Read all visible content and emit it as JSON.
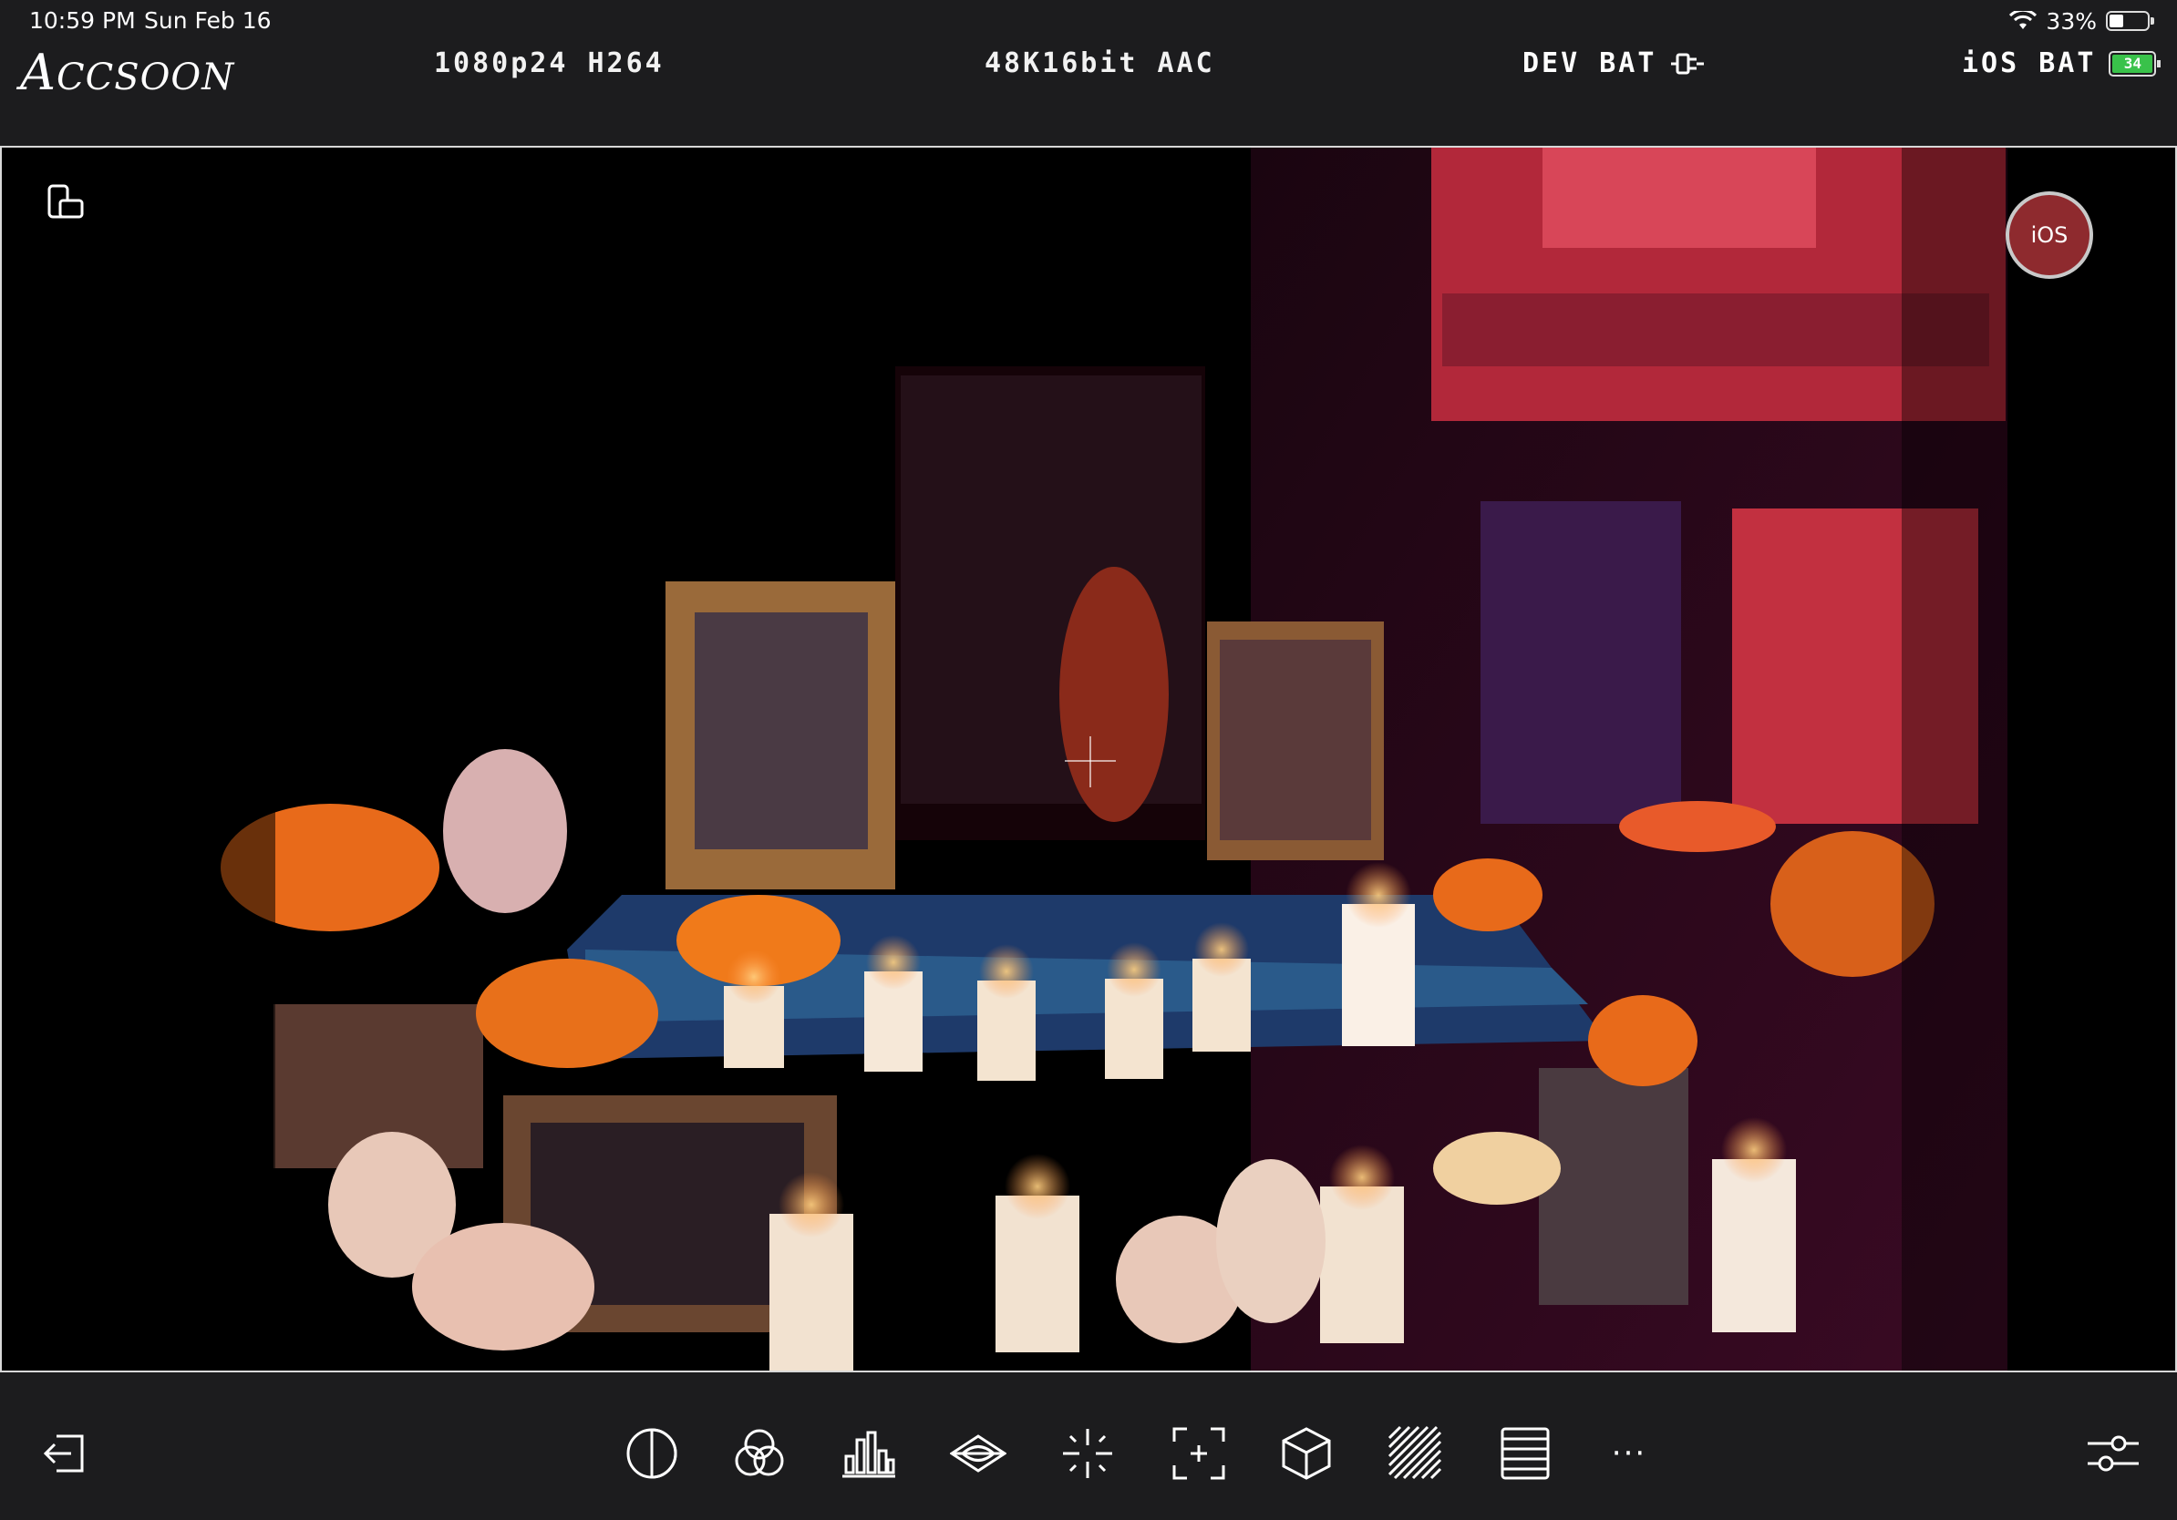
{
  "status_bar": {
    "time": "10:59 PM",
    "date": "Sun Feb 16",
    "battery_percent": "33%",
    "battery_level": 0.33
  },
  "header": {
    "logo_first": "A",
    "logo_rest": "CCSOON",
    "video_format": "1080p24 H264",
    "audio_format": "48K16bit AAC",
    "dev_bat_label": "DEV BAT",
    "ios_bat_label": "iOS BAT",
    "ios_bat_value": "34",
    "ios_bat_level": 0.34
  },
  "viewport": {
    "record_label": "iOS"
  },
  "toolbar": {
    "icons": [
      "exit-icon",
      "exposure-icon",
      "color-channels-icon",
      "histogram-icon",
      "waveform-icon",
      "peaking-icon",
      "frame-guide-icon",
      "lut-cube-icon",
      "zebra-icon",
      "false-color-icon",
      "more-icon",
      "settings-sliders-icon"
    ],
    "more_label": "···"
  },
  "colors": {
    "bar_bg": "#1c1c1e",
    "record": "#8e2a2e",
    "battery_green": "#39c24a"
  }
}
